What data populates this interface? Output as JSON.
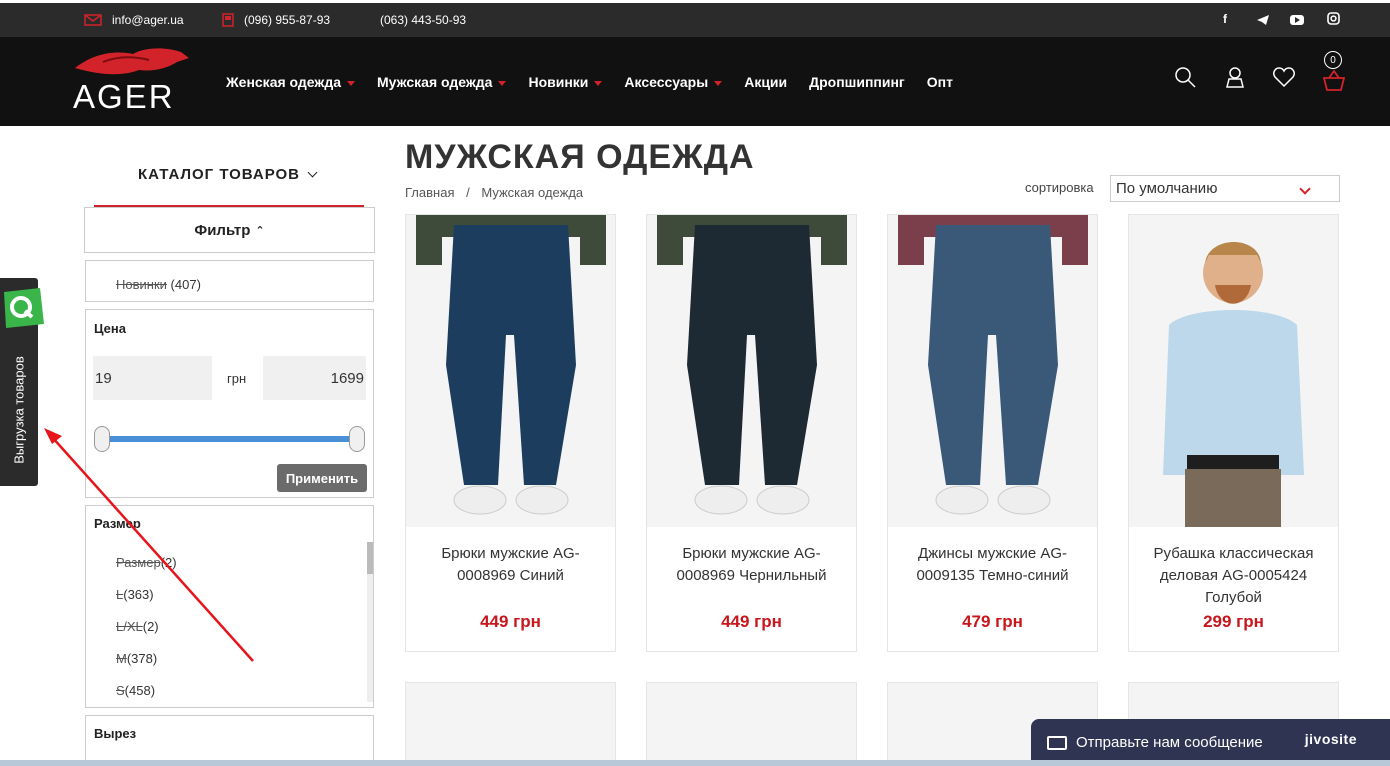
{
  "topbar": {
    "email": "info@ager.ua",
    "phone1": "(096) 955-87-93",
    "phone2": "(063) 443-50-93",
    "social_facebook": "f"
  },
  "header": {
    "logo_text": "AGER",
    "nav": [
      {
        "label": "Женская одежда",
        "has_dropdown": true
      },
      {
        "label": "Мужская одежда",
        "has_dropdown": true
      },
      {
        "label": "Новинки",
        "has_dropdown": true
      },
      {
        "label": "Аксессуары",
        "has_dropdown": true
      },
      {
        "label": "Акции",
        "has_dropdown": false
      },
      {
        "label": "Дропшиппинг",
        "has_dropdown": false
      },
      {
        "label": "Опт",
        "has_dropdown": false
      }
    ],
    "cart_count": "0",
    "accent_color": "#d2232a"
  },
  "side_widget": {
    "label": "Выгрузка товаров"
  },
  "sidebar": {
    "catalog_title": "КАТАЛОГ ТОВАРОВ",
    "filter_label": "Фильтр",
    "new_item": {
      "label": "Новинки",
      "count": "(407)"
    },
    "price": {
      "title": "Цена",
      "min": "19",
      "currency": "грн",
      "max": "1699",
      "apply_label": "Применить"
    },
    "size": {
      "title": "Размер",
      "items": [
        {
          "label": "Размер",
          "count": "(2)"
        },
        {
          "label": "L",
          "count": "(363)"
        },
        {
          "label": "L/XL",
          "count": "(2)"
        },
        {
          "label": "M",
          "count": "(378)"
        },
        {
          "label": "S",
          "count": "(458)"
        }
      ]
    },
    "cut_title": "Вырез"
  },
  "main": {
    "title": "МУЖСКАЯ ОДЕЖДА",
    "breadcrumb": {
      "home": "Главная",
      "separator": "/",
      "current": "Мужская одежда"
    },
    "sort": {
      "label": "сортировка",
      "selected": "По умолчанию"
    },
    "products": [
      {
        "name": "Брюки мужские AG-0008969 Синий",
        "price": "449 грн",
        "pants_color": "#1c3d5e"
      },
      {
        "name": "Брюки мужские AG-0008969 Чернильный",
        "price": "449 грн",
        "pants_color": "#1d2a33"
      },
      {
        "name": "Джинсы мужские AG-0009135 Темно-синий",
        "price": "479 грн",
        "pants_color": "#3a5878"
      },
      {
        "name": "Рубашка классическая деловая AG-0005424 Голубой",
        "price": "299 грн",
        "pants_color": "#bcd8ea"
      }
    ]
  },
  "chat": {
    "label": "Отправьте нам сообщение",
    "brand": "jivosite"
  }
}
